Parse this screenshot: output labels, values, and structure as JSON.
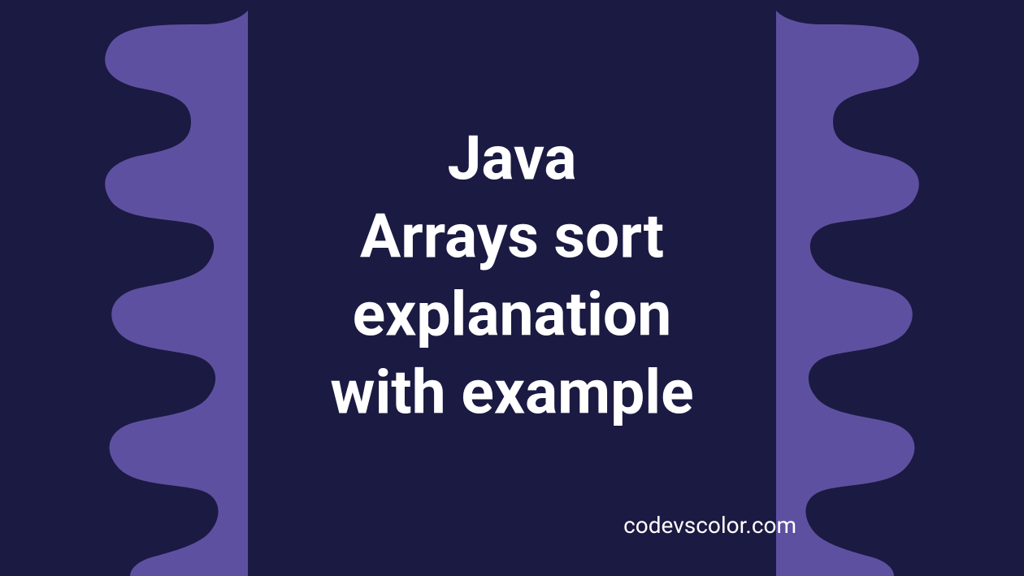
{
  "title": "Java\nArrays sort\nexplanation\nwith example",
  "watermark": "codevscolor.com",
  "colors": {
    "bg_light": "#5e50a1",
    "bg_dark": "#1b1a42",
    "text": "#ffffff"
  }
}
